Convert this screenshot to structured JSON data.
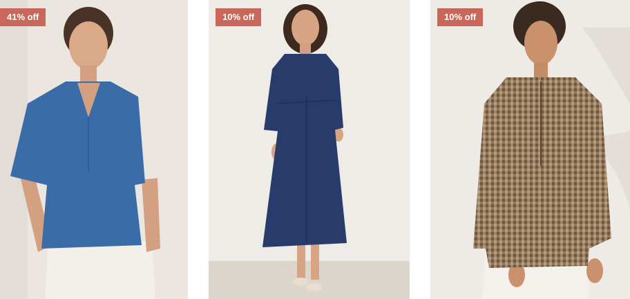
{
  "theme": {
    "badge_color": "#c9675a"
  },
  "products": [
    {
      "badge": "41% off",
      "image_icon": "blue-linen-top-photo"
    },
    {
      "badge": "10% off",
      "image_icon": "navy-linen-dress-photo"
    },
    {
      "badge": "10% off",
      "image_icon": "gingham-linen-top-photo"
    }
  ]
}
